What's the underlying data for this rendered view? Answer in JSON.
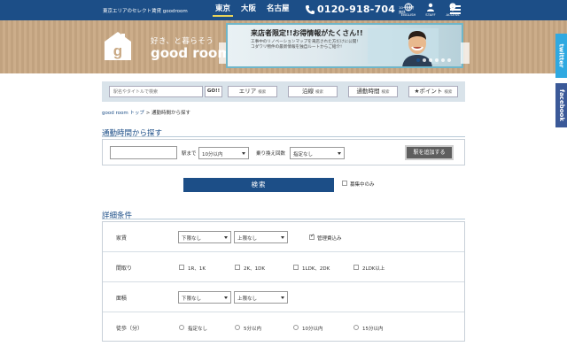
{
  "header": {
    "tagline": "東京エリアのセレクト賃貸 goodroom",
    "cities": [
      {
        "label": "東京",
        "active": true
      },
      {
        "label": "大阪",
        "active": false
      },
      {
        "label": "名古屋",
        "active": false
      }
    ],
    "phone": "0120-918-704",
    "phone_hours": "10～20時 無休",
    "icons": [
      {
        "name": "english-icon",
        "label": "ENGLISH"
      },
      {
        "name": "staff-icon",
        "label": "STAFF"
      },
      {
        "name": "access-icon",
        "label": "ACCESS"
      }
    ],
    "accent": "#1c4e87"
  },
  "hero": {
    "slogan": "好き、と暮らそう",
    "brand": "good room",
    "banner": {
      "title": "来店者限定!!お得情報がたくさん!!",
      "line1": "工事中のリノベーションマップを来店された方だけに公開!",
      "line2": "コダワリ物件の最新情報を独自ルートからご紹介!"
    },
    "slides": 6,
    "active_slide": 1
  },
  "searchbar": {
    "placeholder": "駅名やタイトルで検索",
    "go_label": "GO!!",
    "buttons": [
      {
        "label": "エリア",
        "sub": "検索"
      },
      {
        "label": "沿線",
        "sub": "検索"
      },
      {
        "label": "通勤時間",
        "sub": "検索"
      },
      {
        "label": "★ポイント",
        "sub": "検索"
      }
    ]
  },
  "breadcrumb": {
    "home": "good room トップ",
    "sep": ">",
    "current": "通勤時間から探す"
  },
  "commute": {
    "title": "通勤時間から探す",
    "station_value": "",
    "until_label": "駅まで",
    "time_value": "10分以内",
    "transfer_label": "乗り換え回数",
    "transfer_value": "指定なし",
    "add_label": "駅を追加する"
  },
  "search": {
    "button_label": "検索",
    "only_label": "募集中のみ",
    "only_checked": false
  },
  "details": {
    "title": "詳細条件",
    "rent": {
      "label": "家賃",
      "min": "下限なし",
      "max": "上限なし",
      "mgmt_label": "管理費込み",
      "mgmt_checked": true
    },
    "layout": {
      "label": "間取り",
      "options": [
        "1R、1K",
        "2K、1DK",
        "1LDK、2DK",
        "2LDK以上"
      ]
    },
    "area": {
      "label": "面積",
      "min": "下限なし",
      "max": "上限なし"
    },
    "walk": {
      "label": "徒歩（分）",
      "options": [
        "指定なし",
        "5分以内",
        "10分以内",
        "15分以内"
      ]
    }
  },
  "side": {
    "twitter": "twitter",
    "facebook": "facebook"
  }
}
